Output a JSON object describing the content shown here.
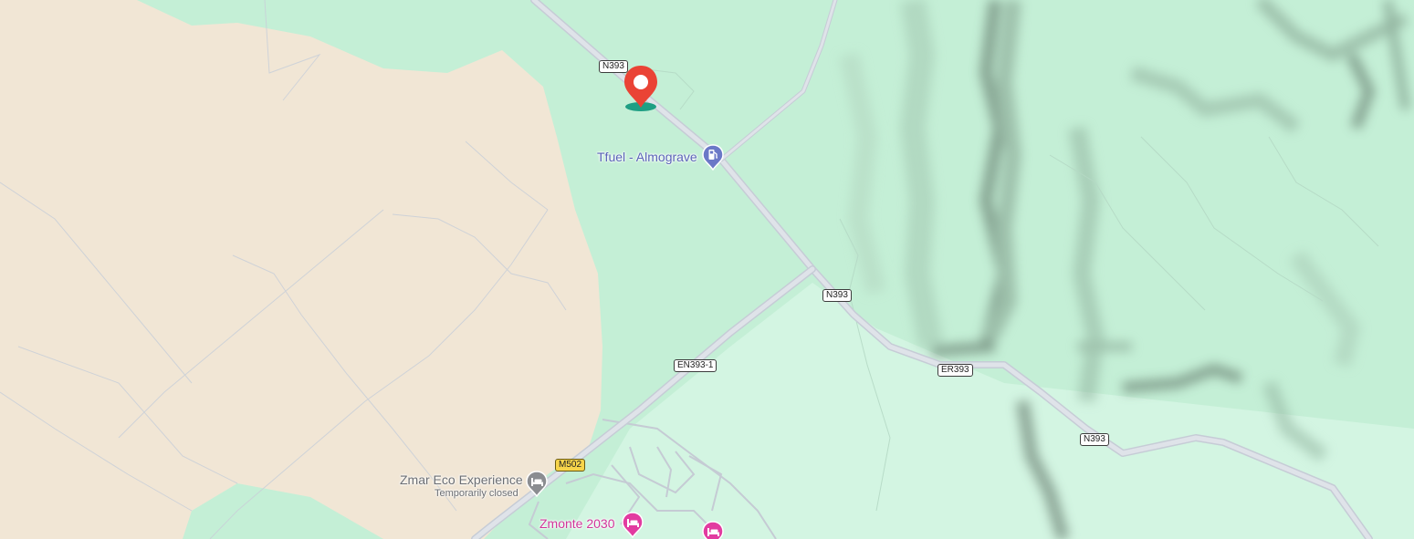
{
  "map": {
    "colors": {
      "vegetation": "#c4efd6",
      "vegetation_light": "#d3f5e2",
      "sand": "#f1e6d5",
      "road": "#d9dde4",
      "road_casing": "#c6ccd6",
      "terrain_shadow": "#5e6e63",
      "fuel_accent": "#6b78c7",
      "hotel_accent": "#e23ba0",
      "closed_grey": "#8b8d91",
      "pin_red": "#ea4335",
      "pin_base": "#1f9f84"
    },
    "road_shields": [
      {
        "id": "n393-north",
        "label": "N393",
        "style": "white"
      },
      {
        "id": "n393-mid",
        "label": "N393",
        "style": "white"
      },
      {
        "id": "en393-1",
        "label": "EN393-1",
        "style": "white"
      },
      {
        "id": "er393",
        "label": "ER393",
        "style": "white"
      },
      {
        "id": "n393-east",
        "label": "N393",
        "style": "white"
      },
      {
        "id": "m502",
        "label": "M502",
        "style": "yellow"
      }
    ],
    "pois": {
      "fuel": {
        "name": "Tfuel - Almograve",
        "icon": "fuel-pump-icon"
      },
      "eco": {
        "name": "Zmar Eco Experience",
        "status": "Temporarily closed",
        "icon": "hotel-bed-icon"
      },
      "zmonte": {
        "name": "Zmonte 2030",
        "icon": "hotel-bed-icon"
      },
      "hotel2": {
        "name": "",
        "icon": "hotel-bed-icon"
      }
    },
    "pin": {
      "icon": "location-pin-icon"
    }
  }
}
